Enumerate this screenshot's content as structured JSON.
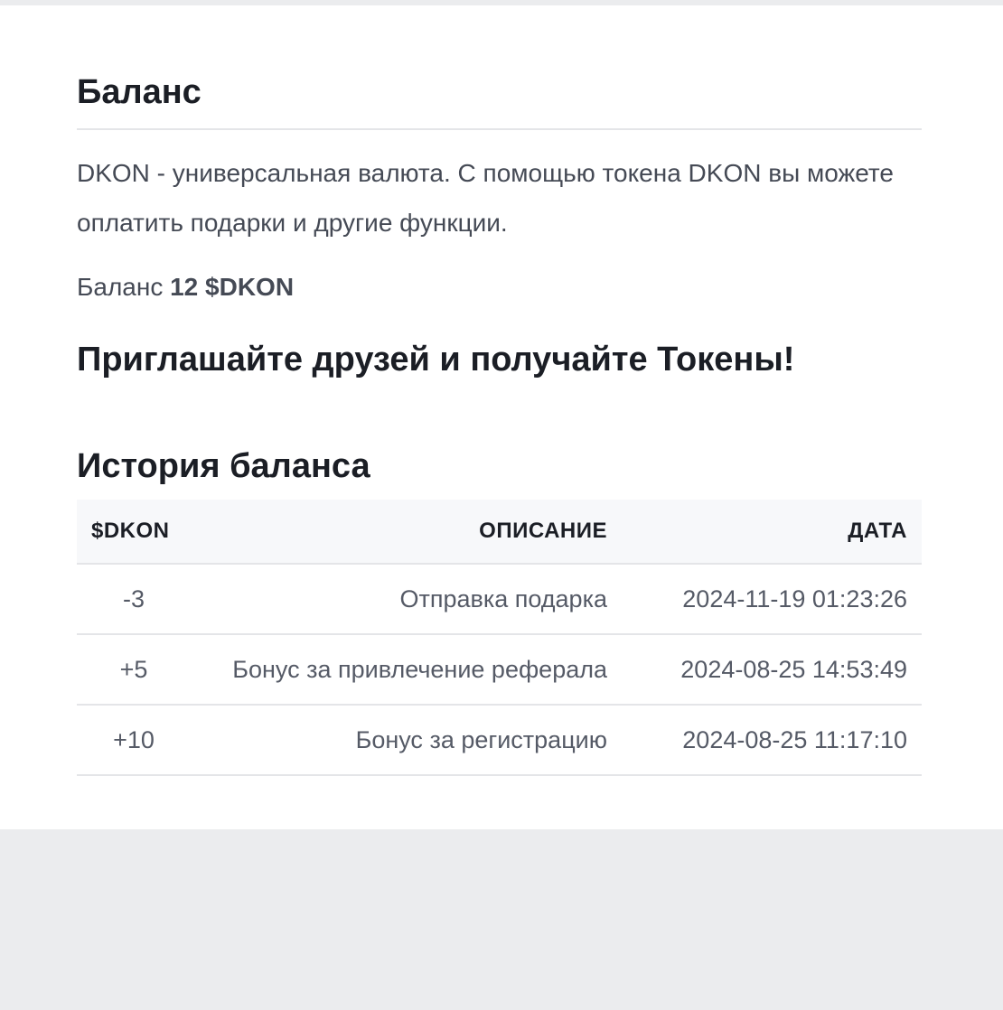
{
  "balance_section": {
    "title": "Баланс",
    "description": "DKON - универсальная валюта. С помощью токена DKON вы можете оплатить подарки и другие функции.",
    "balance_label": "Баланс",
    "balance_value": "12 $DKON"
  },
  "invite": {
    "heading": "Приглашайте друзей и получайте Токены!"
  },
  "history": {
    "heading": "История баланса",
    "columns": [
      "$DKON",
      "ОПИСАНИЕ",
      "ДАТА"
    ],
    "rows": [
      {
        "amount": "-3",
        "description": "Отправка подарка",
        "date": "2024-11-19 01:23:26"
      },
      {
        "amount": "+5",
        "description": "Бонус за привлечение реферала",
        "date": "2024-08-25 14:53:49"
      },
      {
        "amount": "+10",
        "description": "Бонус за регистрацию",
        "date": "2024-08-25 11:17:10"
      }
    ]
  },
  "colors": {
    "negative": "#c6382c",
    "positive": "#6aab3a",
    "header_bg": "#f7f8fa",
    "page_bg": "#ebecee"
  }
}
